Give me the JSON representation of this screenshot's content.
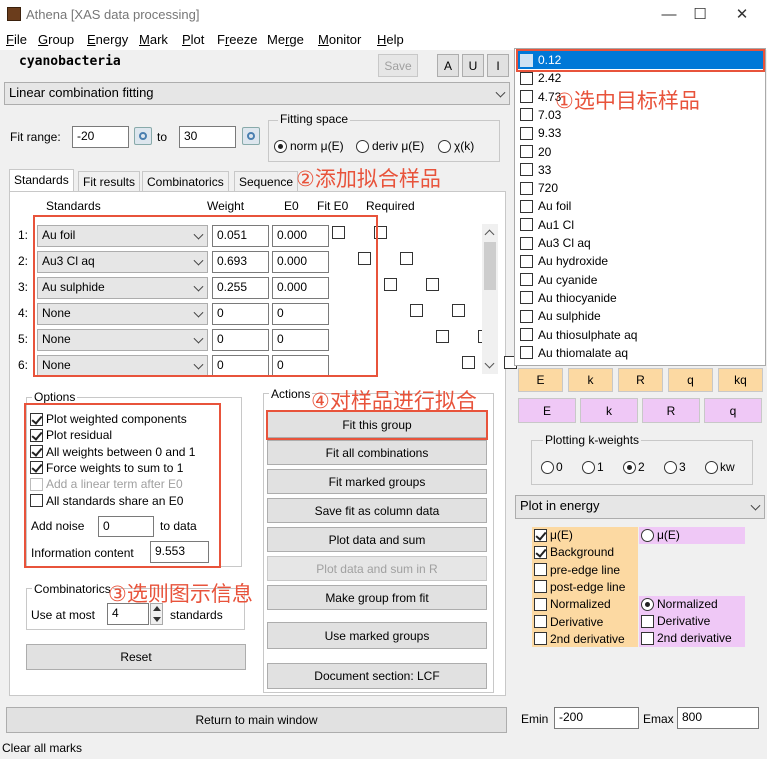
{
  "window": {
    "title": "Athena [XAS data processing]",
    "minimize": "—",
    "maximize": "☐",
    "close": "✕"
  },
  "menu": [
    "File",
    "Group",
    "Energy",
    "Mark",
    "Plot",
    "Freeze",
    "Merge",
    "Monitor",
    "Help"
  ],
  "group_name": "cyanobacteria",
  "header_buttons": {
    "save": "Save",
    "a": "A",
    "u": "U",
    "i": "I"
  },
  "tool_select": "Linear combination fitting",
  "fit_range": {
    "label": "Fit range:",
    "from": "-20",
    "to_label": "to",
    "to": "30"
  },
  "fitting_space": {
    "title": "Fitting space",
    "options": [
      "norm μ(E)",
      "deriv μ(E)",
      "χ(k)"
    ],
    "selected": 0
  },
  "tabs": [
    "Standards",
    "Fit results",
    "Combinatorics",
    "Sequence"
  ],
  "standards_header": {
    "standards": "Standards",
    "weight": "Weight",
    "e0": "E0",
    "fit_e0": "Fit E0",
    "required": "Required"
  },
  "standards": [
    {
      "num": "1:",
      "name": "Au foil",
      "weight": "0.051",
      "e0": "0.000"
    },
    {
      "num": "2:",
      "name": "Au3 Cl aq",
      "weight": "0.693",
      "e0": "0.000"
    },
    {
      "num": "3:",
      "name": "Au sulphide",
      "weight": "0.255",
      "e0": "0.000"
    },
    {
      "num": "4:",
      "name": "None",
      "weight": "0",
      "e0": "0"
    },
    {
      "num": "5:",
      "name": "None",
      "weight": "0",
      "e0": "0"
    },
    {
      "num": "6:",
      "name": "None",
      "weight": "0",
      "e0": "0"
    }
  ],
  "options": {
    "title": "Options",
    "checks": [
      {
        "label": "Plot weighted components",
        "checked": true
      },
      {
        "label": "Plot residual",
        "checked": true
      },
      {
        "label": "All weights between 0 and 1",
        "checked": true
      },
      {
        "label": "Force weights to sum to 1",
        "checked": true
      },
      {
        "label": "Add a linear term after E0",
        "checked": false,
        "disabled": true
      },
      {
        "label": "All standards share an E0",
        "checked": false
      }
    ],
    "add_noise_label": "Add noise",
    "add_noise": "0",
    "to_data": "to data",
    "info_label": "Information content",
    "info_value": "9.553"
  },
  "combinatorics": {
    "title": "Combinatorics",
    "use_at_most": "Use at most",
    "value": "4",
    "standards": "standards"
  },
  "reset": "Reset",
  "actions": {
    "title": "Actions",
    "buttons": [
      "Fit this group",
      "Fit all combinations",
      "Fit marked groups",
      "Save fit as column data",
      "Plot data and sum",
      "Plot data and sum in R",
      "Make group from fit",
      "Use marked groups",
      "Document section: LCF"
    ]
  },
  "return_button": "Return to main window",
  "status": "Clear all marks",
  "group_list": [
    "0.12",
    "2.42",
    "4.73",
    "7.03",
    "9.33",
    "20",
    "33",
    "720",
    "Au foil",
    "Au1 Cl",
    "Au3 Cl aq",
    "Au hydroxide",
    "Au cyanide",
    "Au thiocyanide",
    "Au sulphide",
    "Au thiosulphate aq",
    "Au thiomalate aq"
  ],
  "plot_buttons_row1": [
    "E",
    "k",
    "R",
    "q",
    "kq"
  ],
  "plot_buttons_row2": [
    "E",
    "k",
    "R",
    "q"
  ],
  "kweights": {
    "title": "Plotting k-weights",
    "options": [
      "0",
      "1",
      "2",
      "3",
      "kw"
    ],
    "selected": 2
  },
  "plot_in": "Plot in energy",
  "energy_left": [
    {
      "label": "μ(E)",
      "checked": true
    },
    {
      "label": "Background",
      "checked": true
    },
    {
      "label": "pre-edge line",
      "checked": false
    },
    {
      "label": "post-edge line",
      "checked": false
    },
    {
      "label": "Normalized",
      "checked": false
    },
    {
      "label": "Derivative",
      "checked": false
    },
    {
      "label": "2nd derivative",
      "checked": false
    }
  ],
  "energy_right": {
    "mu_label": "μ(E)",
    "norm_label": "Normalized",
    "deriv_label": "Derivative",
    "deriv2_label": "2nd derivative"
  },
  "emin": {
    "label": "Emin",
    "value": "-200"
  },
  "emax": {
    "label": "Emax",
    "value": "800"
  },
  "annotations": [
    "①选中目标样品",
    "②添加拟合样品",
    "③选则图示信息",
    "④对样品进行拟合"
  ],
  "colors": {
    "annotation": "#e8533b",
    "selected": "#0078d7",
    "orange": "#fcd9a2",
    "purple": "#efc8f6"
  }
}
